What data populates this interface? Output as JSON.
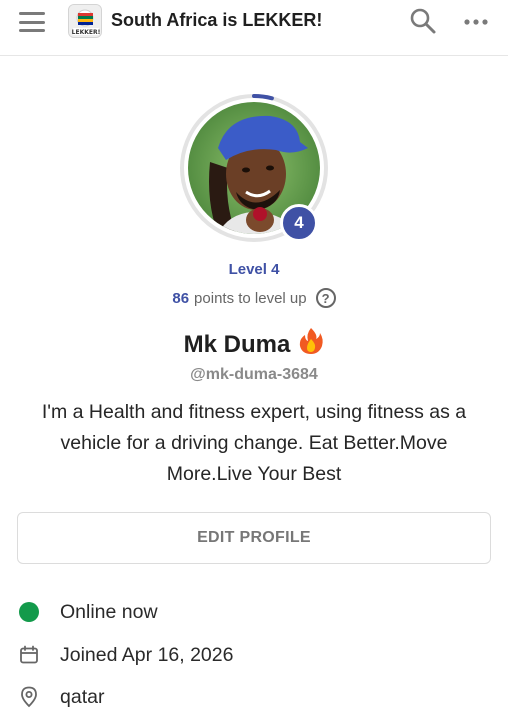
{
  "header": {
    "title": "South Africa is LEKKER!",
    "logo_text": "LEKKER!"
  },
  "profile": {
    "level_badge": "4",
    "level_label": "Level 4",
    "points": "86",
    "points_suffix": "points to level up",
    "help_glyph": "?",
    "name": "Mk Duma",
    "name_emoji": "🔥",
    "handle": "@mk-duma-3684",
    "bio": "I'm a Health and fitness expert, using fitness as a vehicle for a driving change. Eat Better.Move More.Live Your Best",
    "level_progress": 0.04
  },
  "actions": {
    "edit_profile": "EDIT PROFILE"
  },
  "details": {
    "status": "Online now",
    "joined": "Joined Apr 16, 2026",
    "location": "qatar"
  },
  "colors": {
    "accent": "#3f51a5",
    "online": "#139a4b"
  },
  "icons": [
    "menu-icon",
    "search-icon",
    "more-icon",
    "help-icon",
    "calendar-icon",
    "location-pin-icon"
  ]
}
